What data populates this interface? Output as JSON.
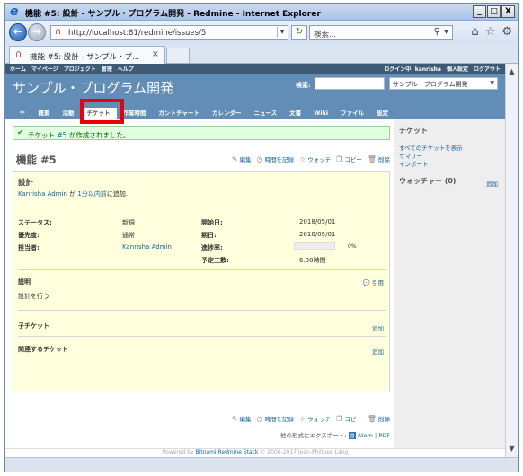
{
  "window": {
    "title": "機能 #5: 設計 - サンプル・プログラム開発 - Redmine - Internet Explorer",
    "min": "_",
    "max": "□",
    "close": "X"
  },
  "browser": {
    "url": "http://localhost:81/redmine/issues/5",
    "search_placeholder": "検索...",
    "tab_label": "機能 #5: 設計 - サンプル・プ...",
    "tab_close": "×"
  },
  "top_menu": {
    "left": [
      "ホーム",
      "マイページ",
      "プロジェクト",
      "管理",
      "ヘルプ"
    ],
    "logged_in": "ログイン中: kanrisha",
    "right": [
      "個人設定",
      "ログアウト"
    ]
  },
  "header": {
    "project_title": "サンプル・プログラム開発",
    "search_label": "検索:",
    "project_select": "サンプル・プログラム開発"
  },
  "main_menu": {
    "items": [
      "+",
      "概要",
      "活動",
      "チケット",
      "作業時間",
      "ガントチャート",
      "カレンダー",
      "ニュース",
      "文書",
      "Wiki",
      "ファイル",
      "設定"
    ],
    "selected_index": 3
  },
  "flash": {
    "prefix": "チケット",
    "link": "#5",
    "suffix": "が作成されました。"
  },
  "issue": {
    "title": "機能 #5",
    "subject": "設計",
    "author_name": "Kanrisha Admin",
    "author_mid": "が",
    "author_time": "1分以内前",
    "author_suffix": "に追加.",
    "attributes": {
      "status_label": "ステータス:",
      "status": "新規",
      "priority_label": "優先度:",
      "priority": "通常",
      "assignee_label": "担当者:",
      "assignee": "Kanrisha Admin",
      "start_label": "開始日:",
      "start": "2018/05/01",
      "due_label": "期日:",
      "due": "2018/05/01",
      "progress_label": "進捗率:",
      "progress": "0%",
      "estimated_label": "予定工数:",
      "estimated": "6.00時間"
    },
    "progress_value": 0,
    "description_title": "説明",
    "quote": "引用",
    "description": "設計を行う",
    "subtasks_title": "子チケット",
    "subtasks_add": "追加",
    "relations_title": "関連するチケット",
    "relations_add": "追加"
  },
  "actions": {
    "edit": "編集",
    "log_time": "時間を記録",
    "watch": "ウォッチ",
    "copy": "コピー",
    "delete": "削除"
  },
  "export": {
    "prefix": "他の形式にエクスポート:",
    "atom": "Atom",
    "sep": "|",
    "pdf": "PDF"
  },
  "sidebar": {
    "title": "チケット",
    "links": [
      "すべてのチケットを表示",
      "サマリー",
      "インポート"
    ],
    "watchers": "ウォッチャー (0)",
    "watchers_add": "追加"
  },
  "footer": {
    "prefix": "Powered by",
    "link": "Bitnami Redmine Stack",
    "suffix": "© 2006-2017 Jean-Philippe Lang"
  },
  "colors": {
    "header": "#628db6",
    "top_menu": "#3e5b76",
    "flash_bg": "#dfffdf",
    "issue_bg": "#ffffdd",
    "highlight": "#e8000b",
    "link": "#116699"
  },
  "icons": [
    "ie-logo-icon",
    "back-icon",
    "forward-icon",
    "redmine-favicon-icon",
    "refresh-icon",
    "search-icon",
    "home-icon",
    "favorites-icon",
    "gear-icon",
    "check-icon",
    "edit-icon",
    "clock-icon",
    "star-icon",
    "copy-icon",
    "delete-icon",
    "quote-icon",
    "feed-icon"
  ]
}
